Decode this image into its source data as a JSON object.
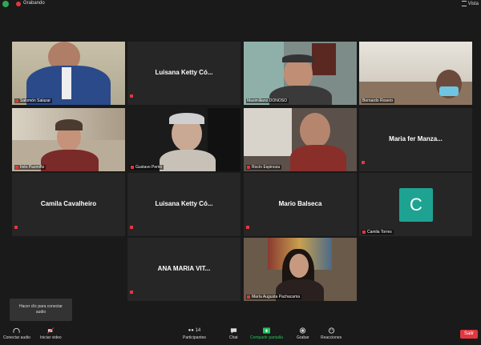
{
  "topbar": {
    "recording_label": "Grabando",
    "view_label": "Vista"
  },
  "participants": [
    {
      "name": "Salomón Salazar"
    },
    {
      "name": "Luisana Ketty Có..."
    },
    {
      "name": "Maximiliano DONOSO"
    },
    {
      "name": "Bernardo Rosero"
    },
    {
      "name": "Inés Pazmiño"
    },
    {
      "name": "Gustavo Perini"
    },
    {
      "name": "Rocío Espinoza"
    },
    {
      "name": "Maria fer Manza..."
    },
    {
      "name": "Camila Cavalheiro"
    },
    {
      "name": "Luisana Ketty Có..."
    },
    {
      "name": "Mario Balseca"
    },
    {
      "name": "Camila Torres",
      "avatar_letter": "C",
      "avatar_color": "#1ea392"
    },
    {
      "name": "ANA MARIA VIT..."
    },
    {
      "name": "María Augusta Pachacama"
    }
  ],
  "tooltip": {
    "line1": "Hacer clic para conectar",
    "line2": "audio"
  },
  "toolbar": {
    "audio": "Conectar audio",
    "video": "Iniciar video",
    "participants": "Participantes",
    "participants_count": "14",
    "chat": "Chat",
    "share": "Compartir pantalla",
    "record": "Grabar",
    "reactions": "Reacciones",
    "leave": "Salir"
  },
  "colors": {
    "speaker_outline": "#cbe04a",
    "mic_muted": "#e0383e",
    "share_green": "#27c15c",
    "leave_red": "#e0383e"
  }
}
